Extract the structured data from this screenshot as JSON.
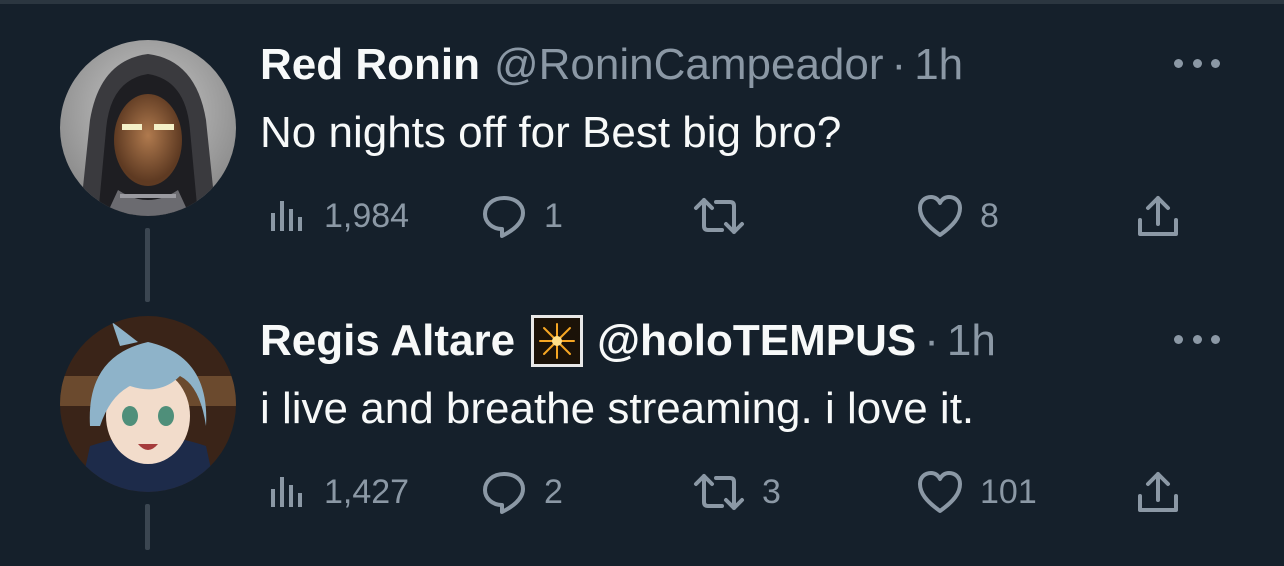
{
  "colors": {
    "background": "#15202b",
    "secondary_text": "#8b98a5",
    "primary_text": "#f7f9f9"
  },
  "tweets": [
    {
      "name": "Red Ronin",
      "handle": "@RoninCampeador",
      "dot": "·",
      "time": "1h",
      "text": "No nights off for Best big bro?",
      "views": "1,984",
      "replies": "1",
      "retweets": "",
      "likes": "8",
      "avatar_icon": "hooded-warrior-avatar"
    },
    {
      "name": "Regis Altare",
      "badge_icon": "sparkler-emoji-icon",
      "handle": "@holoTEMPUS",
      "dot": "·",
      "time": "1h",
      "text": "i live and breathe streaming. i love it.",
      "views": "1,427",
      "replies": "2",
      "retweets": "3",
      "likes": "101",
      "avatar_icon": "anime-character-avatar"
    }
  ]
}
